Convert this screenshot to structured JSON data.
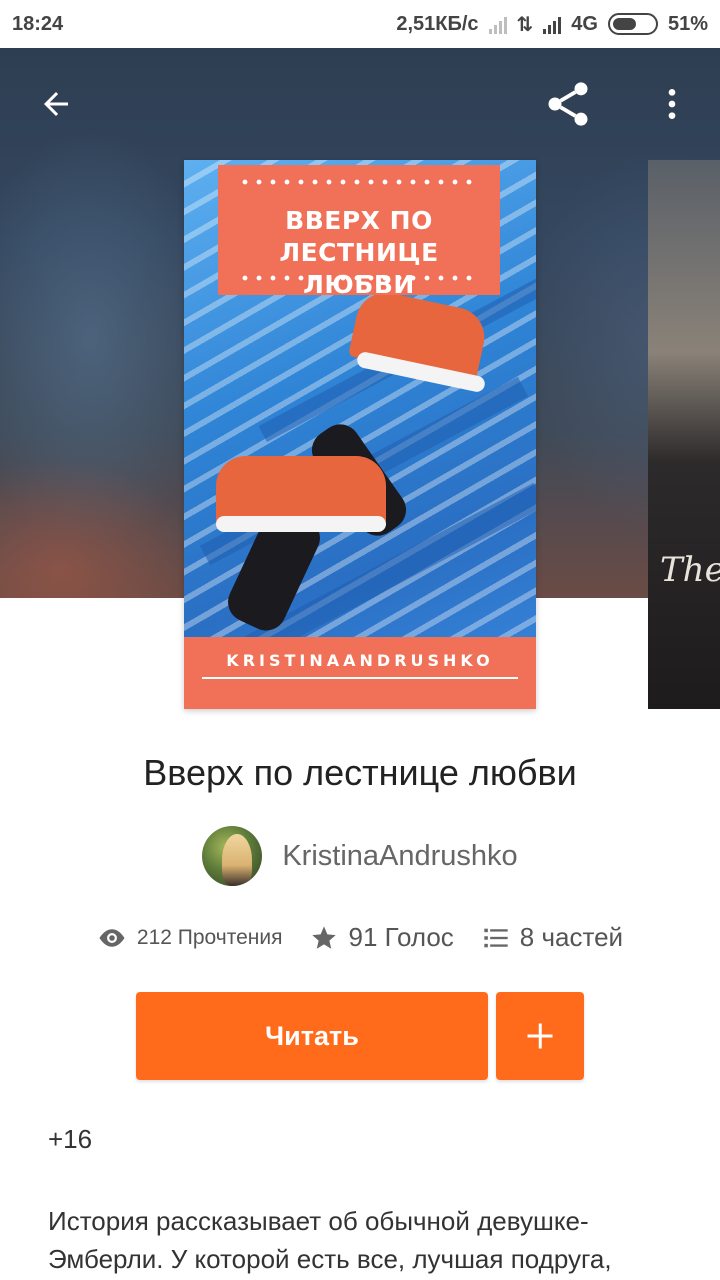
{
  "status_bar": {
    "time": "18:24",
    "speed": "2,51КБ/с",
    "network": "4G",
    "battery": "51%"
  },
  "toolbar": {
    "back_icon": "arrow-left-icon",
    "share_icon": "share-icon",
    "more_icon": "more-vertical-icon"
  },
  "cover": {
    "title": "ВВЕРХ ПО ЛЕСТНИЦЕ ЛЮБВИ",
    "author": "KRISTINAANDRUSHKO",
    "colors": {
      "accent": "#f07058",
      "background": "#2f84d6"
    }
  },
  "next_cover": {
    "text": "The T"
  },
  "story": {
    "title": "Вверх по лестнице любви",
    "author": "KristinaAndrushko",
    "stats": {
      "reads": "212 Прочтения",
      "votes": "91 Голос",
      "parts": "8 частей"
    },
    "read_label": "Читать",
    "add_label": "+",
    "age_rating": "+16",
    "description": "История рассказывает об обычной девушке-Эмберли. У которой есть все, лучшая подруга,"
  },
  "colors": {
    "primary": "#ff6b1a"
  }
}
